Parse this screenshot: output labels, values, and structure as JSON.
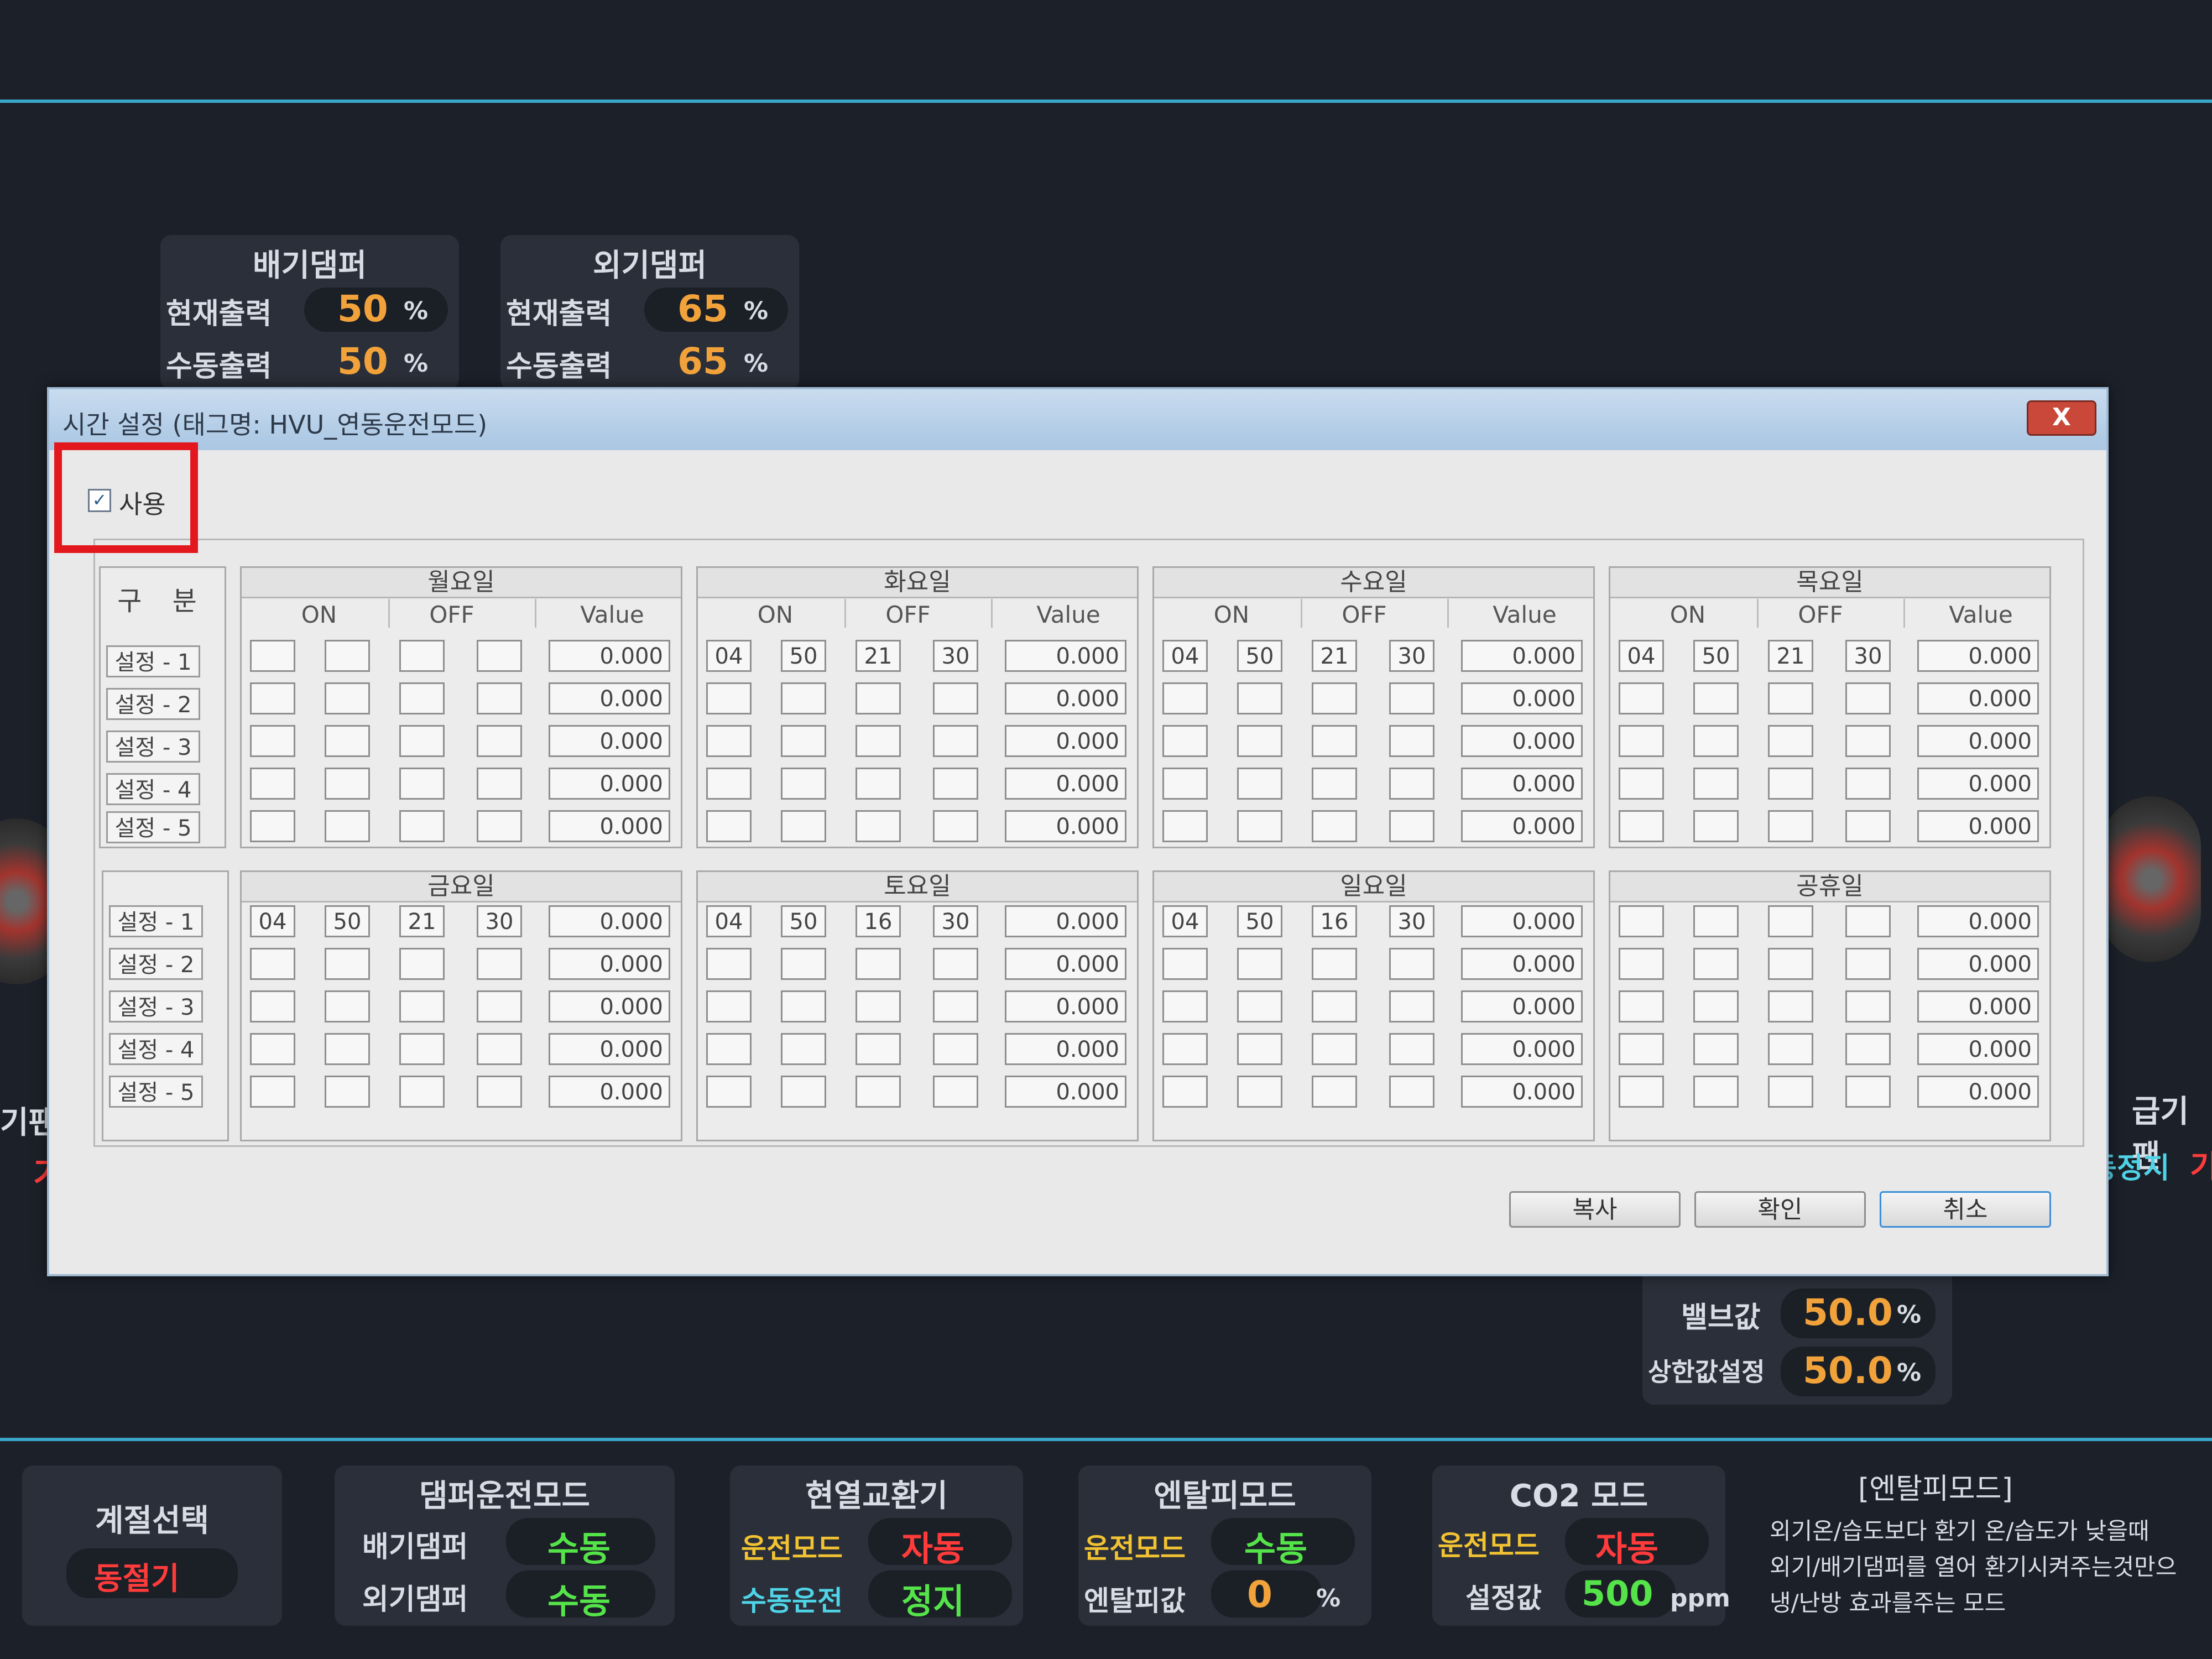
{
  "exhaust_damper": {
    "title": "배기댐퍼",
    "current_label": "현재출력",
    "current_value": "50",
    "manual_label": "수동출력",
    "manual_value": "50",
    "unit": "%"
  },
  "outdoor_damper": {
    "title": "외기댐퍼",
    "current_label": "현재출력",
    "current_value": "65",
    "manual_label": "수동출력",
    "manual_value": "65",
    "unit": "%"
  },
  "side_left": {
    "label": "기팬",
    "value": "기"
  },
  "side_right": {
    "label": "급기팬",
    "value": "동정지",
    "value2": "기"
  },
  "valve": {
    "label": "밸브값",
    "value": "50.0",
    "unit": "%",
    "limit_label": "상한값설정",
    "limit_value": "50.0",
    "limit_unit": "%"
  },
  "dialog": {
    "title": "시간 설정 (태그명: HVU_연동운전모드)",
    "close_label": "X",
    "use_checkbox_label": "사용",
    "use_checked": "✓",
    "category_header": "구 분",
    "settings": [
      "설정 - 1",
      "설정 - 2",
      "설정 - 3",
      "설정 - 4",
      "설정 - 5"
    ],
    "col_on": "ON",
    "col_off": "OFF",
    "col_value": "Value",
    "days": [
      {
        "name": "월요일",
        "rows": [
          [
            "",
            "",
            "",
            "",
            "0.000"
          ],
          [
            "",
            "",
            "",
            "",
            "0.000"
          ],
          [
            "",
            "",
            "",
            "",
            "0.000"
          ],
          [
            "",
            "",
            "",
            "",
            "0.000"
          ],
          [
            "",
            "",
            "",
            "",
            "0.000"
          ]
        ]
      },
      {
        "name": "화요일",
        "rows": [
          [
            "04",
            "50",
            "21",
            "30",
            "0.000"
          ],
          [
            "",
            "",
            "",
            "",
            "0.000"
          ],
          [
            "",
            "",
            "",
            "",
            "0.000"
          ],
          [
            "",
            "",
            "",
            "",
            "0.000"
          ],
          [
            "",
            "",
            "",
            "",
            "0.000"
          ]
        ]
      },
      {
        "name": "수요일",
        "rows": [
          [
            "04",
            "50",
            "21",
            "30",
            "0.000"
          ],
          [
            "",
            "",
            "",
            "",
            "0.000"
          ],
          [
            "",
            "",
            "",
            "",
            "0.000"
          ],
          [
            "",
            "",
            "",
            "",
            "0.000"
          ],
          [
            "",
            "",
            "",
            "",
            "0.000"
          ]
        ]
      },
      {
        "name": "목요일",
        "rows": [
          [
            "04",
            "50",
            "21",
            "30",
            "0.000"
          ],
          [
            "",
            "",
            "",
            "",
            "0.000"
          ],
          [
            "",
            "",
            "",
            "",
            "0.000"
          ],
          [
            "",
            "",
            "",
            "",
            "0.000"
          ],
          [
            "",
            "",
            "",
            "",
            "0.000"
          ]
        ]
      },
      {
        "name": "금요일",
        "rows": [
          [
            "04",
            "50",
            "21",
            "30",
            "0.000"
          ],
          [
            "",
            "",
            "",
            "",
            "0.000"
          ],
          [
            "",
            "",
            "",
            "",
            "0.000"
          ],
          [
            "",
            "",
            "",
            "",
            "0.000"
          ],
          [
            "",
            "",
            "",
            "",
            "0.000"
          ]
        ]
      },
      {
        "name": "토요일",
        "rows": [
          [
            "04",
            "50",
            "16",
            "30",
            "0.000"
          ],
          [
            "",
            "",
            "",
            "",
            "0.000"
          ],
          [
            "",
            "",
            "",
            "",
            "0.000"
          ],
          [
            "",
            "",
            "",
            "",
            "0.000"
          ],
          [
            "",
            "",
            "",
            "",
            "0.000"
          ]
        ]
      },
      {
        "name": "일요일",
        "rows": [
          [
            "04",
            "50",
            "16",
            "30",
            "0.000"
          ],
          [
            "",
            "",
            "",
            "",
            "0.000"
          ],
          [
            "",
            "",
            "",
            "",
            "0.000"
          ],
          [
            "",
            "",
            "",
            "",
            "0.000"
          ],
          [
            "",
            "",
            "",
            "",
            "0.000"
          ]
        ]
      },
      {
        "name": "공휴일",
        "rows": [
          [
            "",
            "",
            "",
            "",
            "0.000"
          ],
          [
            "",
            "",
            "",
            "",
            "0.000"
          ],
          [
            "",
            "",
            "",
            "",
            "0.000"
          ],
          [
            "",
            "",
            "",
            "",
            "0.000"
          ],
          [
            "",
            "",
            "",
            "",
            "0.000"
          ]
        ]
      }
    ],
    "buttons": {
      "copy": "복사",
      "ok": "확인",
      "cancel": "취소"
    }
  },
  "bottom": {
    "season": {
      "title": "계절선택",
      "value": "동절기"
    },
    "damper_mode": {
      "title": "댐퍼운전모드",
      "exhaust_label": "배기댐퍼",
      "exhaust_value": "수동",
      "outdoor_label": "외기댐퍼",
      "outdoor_value": "수동"
    },
    "heat_exchanger": {
      "title": "현열교환기",
      "mode_label": "운전모드",
      "mode_value": "자동",
      "manual_label": "수동운전",
      "manual_value": "정지"
    },
    "enthalpy": {
      "title": "엔탈피모드",
      "mode_label": "운전모드",
      "mode_value": "수동",
      "value_label": "엔탈피값",
      "value": "0",
      "unit": "%"
    },
    "co2": {
      "title": "CO2 모드",
      "mode_label": "운전모드",
      "mode_value": "자동",
      "set_label": "설정값",
      "set_value": "500",
      "unit": "ppm"
    },
    "note": {
      "title": "[엔탈피모드]",
      "line1": "외기온/습도보다 환기 온/습도가 낮을때",
      "line2": "외기/배기댐퍼를 열어 환기시켜주는것만으",
      "line3": "냉/난방 효과를주는 모드"
    }
  },
  "colors": {
    "accent_line": "#3aa6c9",
    "orange_value": "#f1a23a",
    "green_value": "#55e34a",
    "red_value": "#ff3b3b",
    "highlight_box": "#e3181f"
  }
}
